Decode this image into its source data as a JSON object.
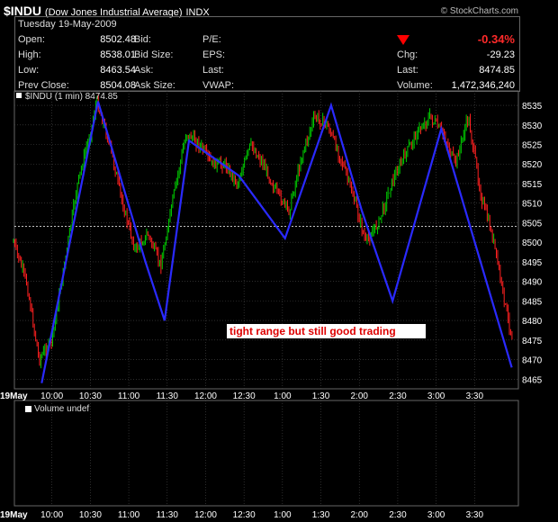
{
  "header": {
    "symbol": "$INDU",
    "name": "(Dow Jones Industrial Average)",
    "exchange": "INDX",
    "brand": "© StockCharts.com",
    "date": "Tuesday 19-May-2009"
  },
  "quote": {
    "open_label": "Open:",
    "open": "8502.48",
    "high_label": "High:",
    "high": "8538.01",
    "low_label": "Low:",
    "low": "8463.54",
    "prevclose_label": "Prev Close:",
    "prevclose": "8504.08",
    "bid_label": "Bid:",
    "bidsize_label": "Bid Size:",
    "ask_label": "Ask:",
    "asksize_label": "Ask Size:",
    "pe_label": "P/E:",
    "eps_label": "EPS:",
    "last2_label": "Last:",
    "vwap_label": "VWAP:",
    "pct": "-0.34%",
    "chg_label": "Chg:",
    "chg": "-29.23",
    "last_label": "Last:",
    "last": "8474.85",
    "volume_label": "Volume:",
    "volume": "1,472,346,240"
  },
  "colors": {
    "up": "#00cc00",
    "down": "#ff2020",
    "trend": "#2a2aff",
    "grid": "#4a4a4a",
    "bg": "#000000"
  },
  "chart_data": {
    "type": "line",
    "title": "$INDU (1 min) 8474.85",
    "x_ticks": [
      "19May",
      "10:00",
      "10:30",
      "11:00",
      "11:30",
      "12:00",
      "12:30",
      "1:00",
      "1:30",
      "2:00",
      "2:30",
      "3:00",
      "3:30"
    ],
    "y_ticks": [
      8465,
      8470,
      8475,
      8480,
      8485,
      8490,
      8495,
      8500,
      8505,
      8510,
      8515,
      8520,
      8525,
      8530,
      8535
    ],
    "ylim": [
      8463,
      8538
    ],
    "reference_line": 8504.08,
    "series": [
      {
        "values": [
          [
            "9:30",
            8500
          ],
          [
            "9:40",
            8490
          ],
          [
            "9:50",
            8470
          ],
          [
            "10:00",
            8475
          ],
          [
            "10:10",
            8495
          ],
          [
            "10:20",
            8515
          ],
          [
            "10:30",
            8528
          ],
          [
            "10:35",
            8536
          ],
          [
            "10:45",
            8525
          ],
          [
            "10:55",
            8510
          ],
          [
            "11:05",
            8498
          ],
          [
            "11:15",
            8502
          ],
          [
            "11:25",
            8494
          ],
          [
            "11:35",
            8512
          ],
          [
            "11:45",
            8528
          ],
          [
            "11:55",
            8525
          ],
          [
            "12:05",
            8520
          ],
          [
            "12:15",
            8520
          ],
          [
            "12:25",
            8515
          ],
          [
            "12:35",
            8525
          ],
          [
            "12:45",
            8520
          ],
          [
            "12:55",
            8513
          ],
          [
            "1:05",
            8508
          ],
          [
            "1:15",
            8522
          ],
          [
            "1:25",
            8532
          ],
          [
            "1:35",
            8530
          ],
          [
            "1:45",
            8522
          ],
          [
            "1:55",
            8512
          ],
          [
            "2:05",
            8500
          ],
          [
            "2:15",
            8505
          ],
          [
            "2:25",
            8515
          ],
          [
            "2:35",
            8522
          ],
          [
            "2:45",
            8528
          ],
          [
            "2:55",
            8532
          ],
          [
            "3:05",
            8528
          ],
          [
            "3:15",
            8520
          ],
          [
            "3:25",
            8532
          ],
          [
            "3:35",
            8512
          ],
          [
            "3:45",
            8500
          ],
          [
            "3:55",
            8482
          ],
          [
            "4:00",
            8474.85
          ]
        ]
      }
    ],
    "trendline": [
      [
        "9:52",
        8464
      ],
      [
        "10:36",
        8536
      ],
      [
        "11:13",
        8495
      ],
      [
        "11:28",
        8480
      ],
      [
        "11:47",
        8526
      ],
      [
        "12:26",
        8517
      ],
      [
        "1:02",
        8501
      ],
      [
        "1:38",
        8535
      ],
      [
        "2:02",
        8508
      ],
      [
        "2:26",
        8485
      ],
      [
        "3:04",
        8529
      ],
      [
        "3:59",
        8468
      ]
    ],
    "annotation": "tight range but still good trading",
    "volume_label": "Volume undef"
  }
}
